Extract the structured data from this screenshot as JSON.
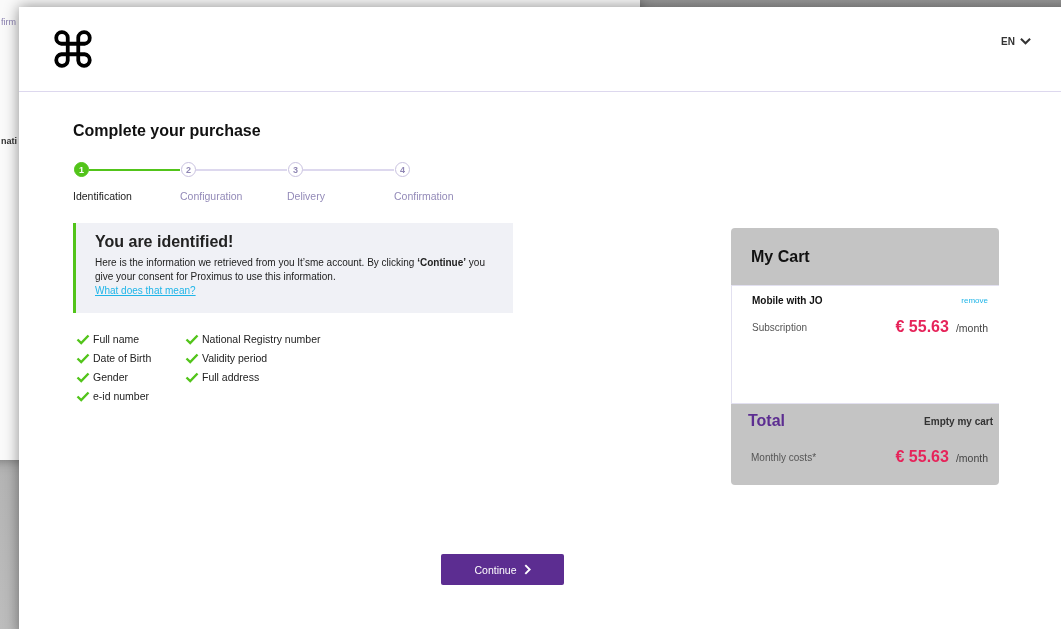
{
  "background_window": {
    "texts": [
      "firm",
      "nati"
    ]
  },
  "header": {
    "language": "EN"
  },
  "title": "Complete your purchase",
  "steps": [
    {
      "number": "1",
      "label": "Identification",
      "selected": true
    },
    {
      "number": "2",
      "label": "Configuration",
      "selected": false
    },
    {
      "number": "3",
      "label": "Delivery",
      "selected": false
    },
    {
      "number": "4",
      "label": "Confirmation",
      "selected": false
    }
  ],
  "notice": {
    "heading": "You are identified!",
    "text": "Here is the information we retrieved from you It’sme account. By clicking **‘Continue’** you give your consent for Proximus to use this information.",
    "link": "What does that mean?"
  },
  "retrieved_fields": [
    {
      "label": "Full name",
      "checked": true
    },
    {
      "label": "National Registry number",
      "checked": true
    },
    {
      "label": "Date of Birth",
      "checked": true
    },
    {
      "label": "Validity period",
      "checked": true
    },
    {
      "label": "Gender",
      "checked": true
    },
    {
      "label": "Full address",
      "checked": true
    },
    {
      "label": "e-id number",
      "checked": true
    }
  ],
  "cart": {
    "title": "My Cart",
    "items": [
      {
        "name": "Mobile with JO",
        "remove": "remove",
        "lines": [
          {
            "label": "Subscription",
            "price": "€ 55.63",
            "period": "/month"
          }
        ]
      }
    ],
    "total": {
      "title": "Total",
      "empty": "Empty my cart",
      "label": "Monthly costs*",
      "price": "€ 55.63",
      "period": "/month"
    }
  },
  "continue_button": "Continue"
}
